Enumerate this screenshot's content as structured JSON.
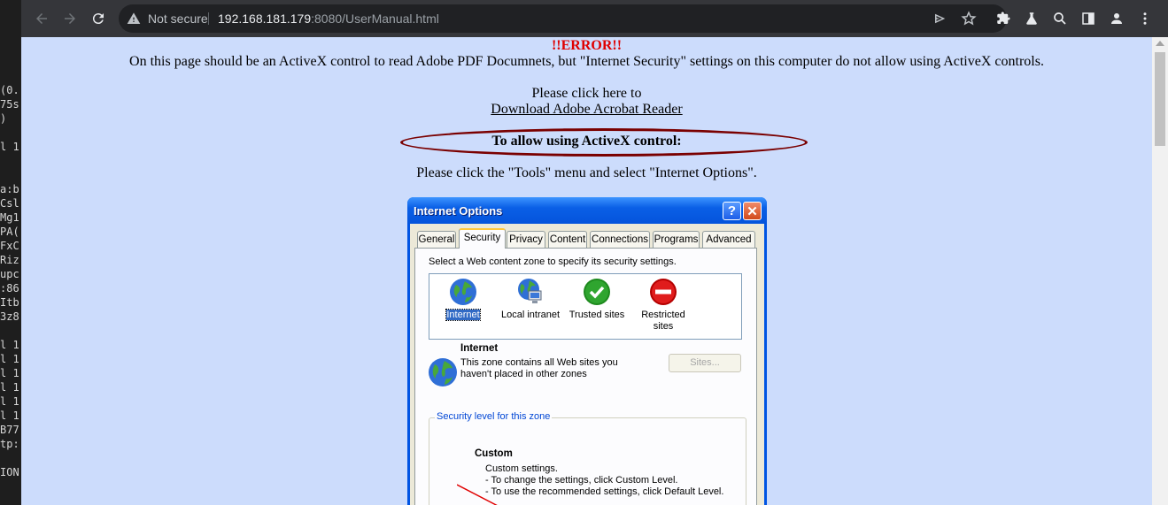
{
  "terminal": {
    "lines": [
      "(0.",
      "75s",
      ")",
      "l 1",
      "a:b",
      "Csl",
      "Mg1",
      "PA(",
      "FxC",
      "Riz",
      "upc",
      ":86",
      "Itb",
      "3z8",
      "l 1",
      "l 1",
      "l 1",
      "l 1",
      "l 1",
      "l 1",
      "B77",
      "tp:",
      "ION"
    ]
  },
  "browser": {
    "security_label": "Not secure",
    "url_host": "192.168.181.179",
    "url_rest": ":8080/UserManual.html",
    "icons": [
      "back-icon",
      "forward-icon",
      "reload-icon",
      "warning-icon",
      "send-icon",
      "star-icon",
      "extensions-icon",
      "labs-icon",
      "search-icon",
      "sidepanel-icon",
      "profile-icon",
      "menu-icon"
    ]
  },
  "page": {
    "error_title": "!!ERROR!!",
    "error_message": "On this page should be an ActiveX control to read Adobe PDF Documnets, but \"Internet Security\" settings on this computer do not allow using ActiveX controls.",
    "click_here": "Please click here to",
    "download_link": "Download Adobe Acrobat Reader",
    "allow_heading": "To allow using ActiveX control:",
    "instruction": "Please click the \"Tools\" menu and select \"Internet Options\"."
  },
  "dialog": {
    "title": "Internet Options",
    "help_glyph": "?",
    "close_glyph": "✕",
    "tabs": [
      "General",
      "Security",
      "Privacy",
      "Content",
      "Connections",
      "Programs",
      "Advanced"
    ],
    "active_tab": "Security",
    "zone_instruction": "Select a Web content zone to specify its security settings.",
    "zones": [
      {
        "label": "Internet",
        "icon": "globe-icon",
        "selected": true
      },
      {
        "label": "Local intranet",
        "icon": "intranet-icon",
        "selected": false
      },
      {
        "label": "Trusted sites",
        "icon": "checkmark-icon",
        "selected": false
      },
      {
        "label": "Restricted sites",
        "icon": "restricted-icon",
        "selected": false
      }
    ],
    "zone_name": "Internet",
    "zone_description": "This zone contains all Web sites you haven't placed in other zones",
    "sites_button": "Sites...",
    "security_group_label": "Security level for this zone",
    "security_level": "Custom",
    "security_desc": [
      "Custom settings.",
      "- To change the settings, click Custom Level.",
      "- To use the recommended settings, click Default Level."
    ]
  },
  "colors": {
    "page_bg": "#ccdcfc",
    "error_red": "#e00000",
    "ellipse": "#7a0000",
    "chrome_bg": "#35363a",
    "xp_title_blue": "#0a5fe6"
  }
}
